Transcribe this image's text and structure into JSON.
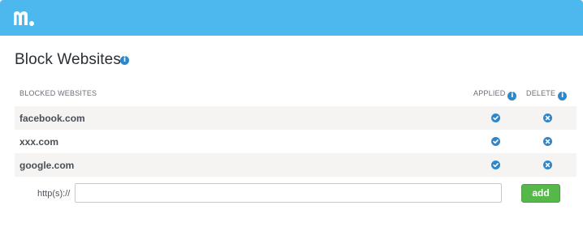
{
  "header": {
    "logo_icon": "mspy-logo-icon",
    "brand_color": "#4db8ee"
  },
  "page": {
    "title": "Block Websites",
    "title_info_icon": "info-icon"
  },
  "table": {
    "columns": {
      "blocked": "BLOCKED WEBSITES",
      "applied": "APPLIED",
      "delete": "DELETE"
    },
    "rows": [
      {
        "site": "facebook.com",
        "applied": true
      },
      {
        "site": "xxx.com",
        "applied": true
      },
      {
        "site": "google.com",
        "applied": true
      }
    ]
  },
  "form": {
    "prefix": "http(s)://",
    "input_value": "",
    "input_placeholder": "",
    "add_label": "add"
  },
  "colors": {
    "accent": "#2f86c9",
    "add_button": "#55b94a"
  }
}
